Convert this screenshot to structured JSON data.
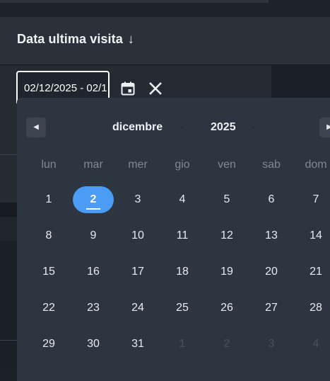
{
  "column": {
    "title": "Data ultima visita",
    "sort_icon": "arrow-down-icon"
  },
  "filter": {
    "date_range_value": "02/12/2025 - 02/1",
    "calendar_icon": "calendar-icon",
    "clear_icon": "close-icon"
  },
  "calendar": {
    "prev_icon": "chevron-left-icon",
    "next_icon": "chevron-right-icon",
    "month": "dicembre",
    "year": "2025",
    "weekdays": [
      "lun",
      "mar",
      "mer",
      "gio",
      "ven",
      "sab",
      "dom"
    ],
    "weeks": [
      [
        "1",
        "2",
        "3",
        "4",
        "5",
        "6",
        "7"
      ],
      [
        "8",
        "9",
        "10",
        "11",
        "12",
        "13",
        "14"
      ],
      [
        "15",
        "16",
        "17",
        "18",
        "19",
        "20",
        "21"
      ],
      [
        "22",
        "23",
        "24",
        "25",
        "26",
        "27",
        "28"
      ],
      [
        "29",
        "30",
        "31",
        "1",
        "2",
        "3",
        "4"
      ]
    ],
    "selected_day": "2"
  },
  "colors": {
    "accent": "#4a9cf5",
    "popup_bg": "#2d3540",
    "header_bg": "#2a313a"
  }
}
